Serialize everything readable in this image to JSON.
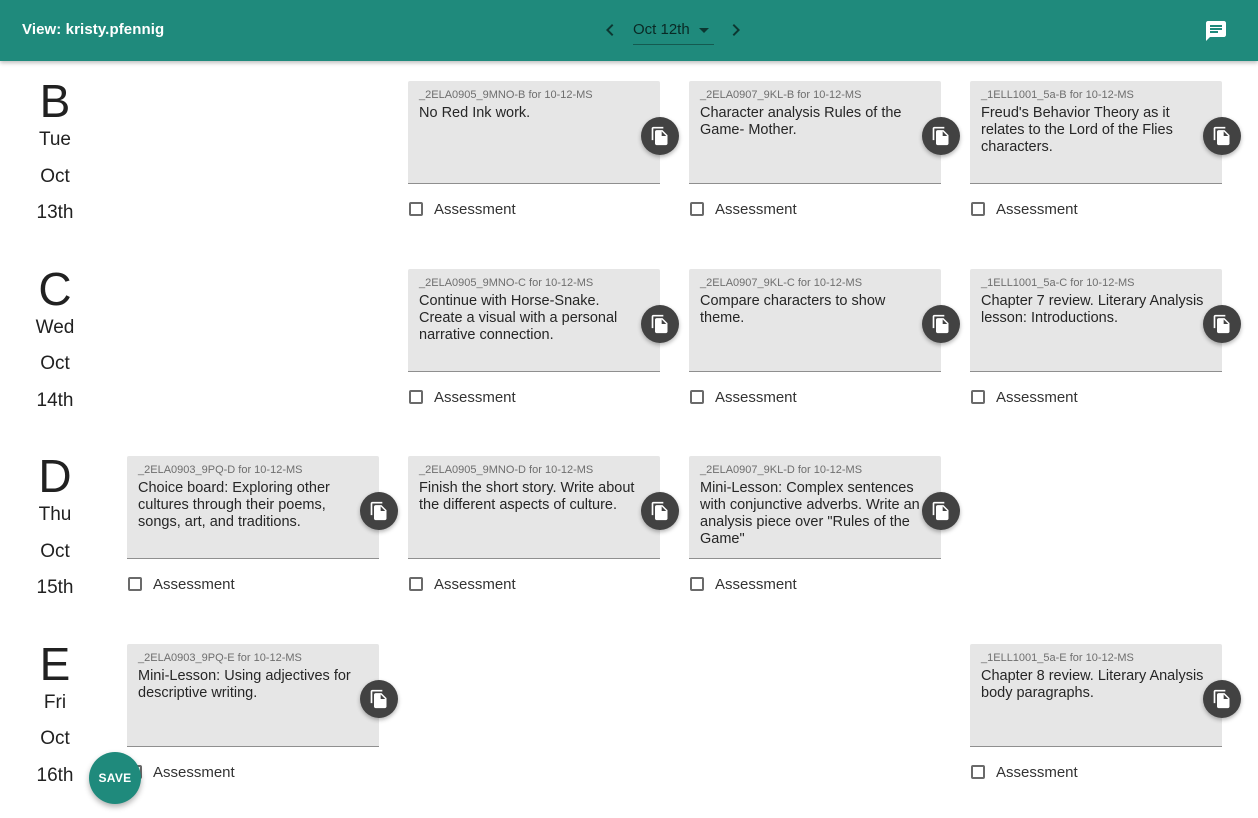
{
  "header": {
    "title": "View: kristy.pfennig",
    "date": "Oct 12th"
  },
  "icons": {
    "prev": "chevron-left-icon",
    "next": "chevron-right-icon",
    "dropdown": "caret-down-icon",
    "messages": "message-icon",
    "copy": "copy-icon"
  },
  "colors": {
    "primary": "#1f8a7c",
    "card_bg": "#e6e6e6",
    "fab_dark": "#424242"
  },
  "assessment_label": "Assessment",
  "days": [
    {
      "letter": "B",
      "weekday": "Tue",
      "month": "Oct",
      "date": "13th"
    },
    {
      "letter": "C",
      "weekday": "Wed",
      "month": "Oct",
      "date": "14th"
    },
    {
      "letter": "D",
      "weekday": "Thu",
      "month": "Oct",
      "date": "15th"
    },
    {
      "letter": "E",
      "weekday": "Fri",
      "month": "Oct",
      "date": "16th"
    }
  ],
  "cards": {
    "b_905": {
      "header": "_2ELA0905_9MNO-B for 10-12-MS",
      "text": "No Red Ink work."
    },
    "b_907": {
      "header": "_2ELA0907_9KL-B for 10-12-MS",
      "text": "Character analysis Rules of the Game- Mother."
    },
    "b_1001": {
      "header": "_1ELL1001_5a-B for 10-12-MS",
      "text": "Freud's Behavior Theory as it relates to the Lord of the Flies characters."
    },
    "c_905": {
      "header": "_2ELA0905_9MNO-C for 10-12-MS",
      "text": "Continue with Horse-Snake. Create a visual with a personal narrative connection."
    },
    "c_907": {
      "header": "_2ELA0907_9KL-C for 10-12-MS",
      "text": "Compare characters to show theme."
    },
    "c_1001": {
      "header": "_1ELL1001_5a-C for 10-12-MS",
      "text": "Chapter 7 review. Literary Analysis lesson: Introductions."
    },
    "d_903": {
      "header": "_2ELA0903_9PQ-D for 10-12-MS",
      "text": "Choice board: Exploring other cultures through their poems, songs, art, and traditions."
    },
    "d_905": {
      "header": "_2ELA0905_9MNO-D for 10-12-MS",
      "text": "Finish the short story. Write about the different aspects of culture."
    },
    "d_907": {
      "header": "_2ELA0907_9KL-D for 10-12-MS",
      "text": "Mini-Lesson: Complex sentences with conjunctive adverbs. Write an analysis piece over \"Rules of the Game\""
    },
    "e_903": {
      "header": "_2ELA0903_9PQ-E for 10-12-MS",
      "text": "Mini-Lesson: Using adjectives for descriptive writing."
    },
    "e_1001": {
      "header": "_1ELL1001_5a-E for 10-12-MS",
      "text": "Chapter 8 review. Literary Analysis body paragraphs."
    }
  },
  "save_label": "SAVE"
}
